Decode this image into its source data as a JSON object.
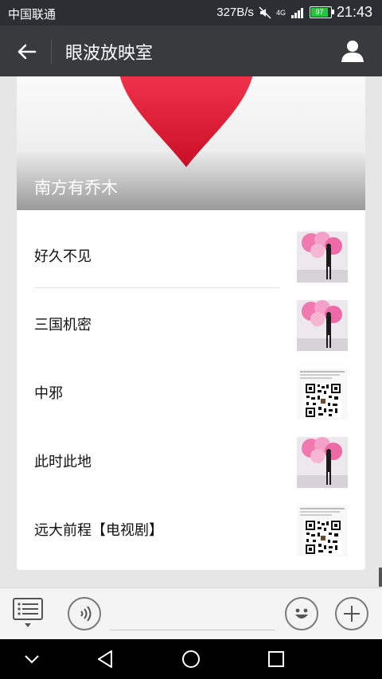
{
  "status_bar": {
    "carrier": "中国联通",
    "net_speed": "327B/s",
    "network_badge": "4G",
    "battery": "97",
    "time": "21:43",
    "icons": [
      "mute-icon",
      "signal-icon",
      "battery-icon"
    ]
  },
  "title_bar": {
    "title": "眼波放映室",
    "icons": [
      "back-arrow-icon",
      "user-profile-icon"
    ]
  },
  "cover": {
    "title": "南方有乔木",
    "image": "red-heart-image"
  },
  "list": [
    {
      "label": "好久不见",
      "thumb": "pink-tree-photo"
    },
    {
      "label": "三国机密",
      "thumb": "pink-tree-photo"
    },
    {
      "label": "中邪",
      "thumb": "qr-code-image"
    },
    {
      "label": "此时此地",
      "thumb": "pink-tree-photo"
    },
    {
      "label": "远大前程【电视剧】",
      "thumb": "qr-code-image"
    }
  ],
  "bottom_bar": {
    "icons": [
      "menu-list-icon",
      "voice-icon",
      "emoji-icon",
      "plus-icon"
    ]
  },
  "nav_bar": {
    "icons": [
      "hide-keyboard-icon",
      "back-triangle-icon",
      "home-circle-icon",
      "recents-square-icon"
    ]
  },
  "colors": {
    "status_bar": "#2b2f33",
    "title_bar": "#393a3e",
    "background": "#e6e6e6",
    "heart": "#e8203a",
    "battery": "#27c53a"
  }
}
